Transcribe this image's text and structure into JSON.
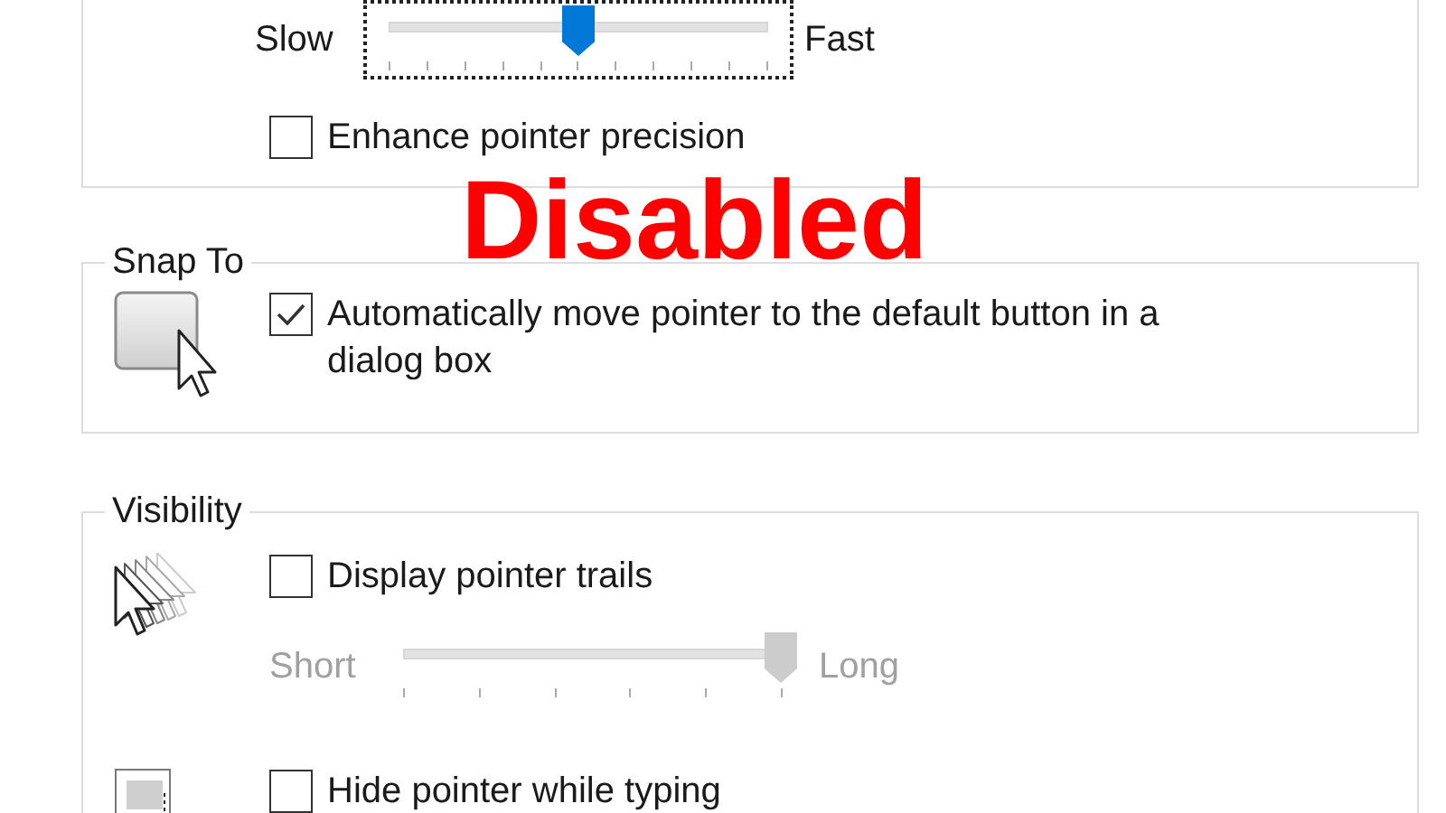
{
  "groups": [
    {
      "rows": [
        {
          "kind": "slider",
          "low_label": "Slow",
          "high_label": "Fast",
          "level": 0.5,
          "focused": true,
          "disabled": false
        },
        {
          "kind": "checkbox",
          "label": "Enhance pointer precision",
          "checked": false
        }
      ]
    },
    {
      "title": "Snap To",
      "rows": [
        {
          "kind": "checkbox",
          "label": "Automatically move pointer to the default button in a dialog box",
          "checked": true
        }
      ]
    },
    {
      "title": "Visibility",
      "rows": [
        {
          "kind": "checkbox",
          "label": "Display pointer trails",
          "checked": false
        },
        {
          "kind": "slider",
          "low_label": "Short",
          "high_label": "Long",
          "level": 1,
          "focused": false,
          "disabled": true
        },
        {
          "kind": "checkbox",
          "label": "Hide pointer while typing",
          "checked": false
        }
      ]
    }
  ],
  "annotation": "Disabled"
}
